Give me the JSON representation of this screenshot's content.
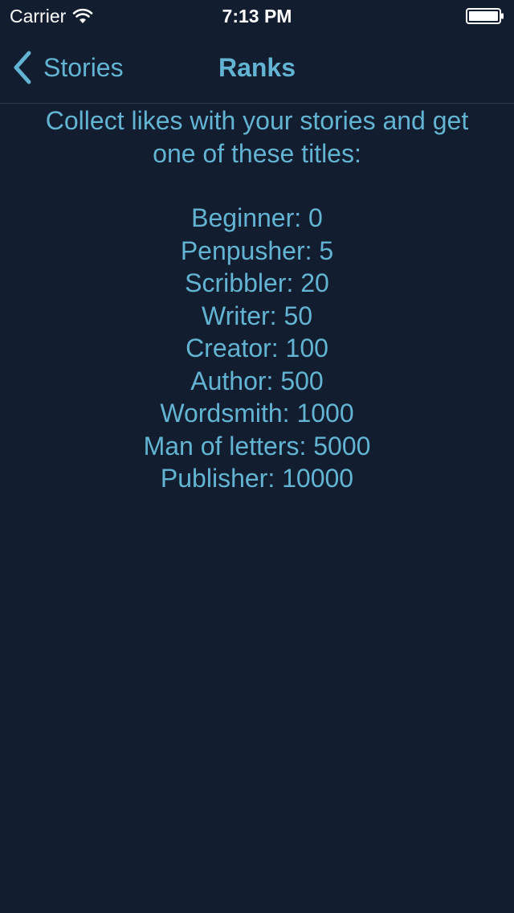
{
  "status_bar": {
    "carrier": "Carrier",
    "time": "7:13 PM",
    "wifi_icon": "wifi-icon",
    "battery_icon": "battery-icon"
  },
  "nav": {
    "back_label": "Stories",
    "back_icon": "chevron-left-icon",
    "title": "Ranks"
  },
  "content": {
    "intro_line1": "Collect likes with your stories and get",
    "intro_line2": "one of these titles:",
    "ranks": [
      "Beginner: 0",
      "Penpusher: 5",
      "Scribbler: 20",
      "Writer: 50",
      "Creator: 100",
      "Author: 500",
      "Wordsmith: 1000",
      "Man of letters: 5000",
      "Publisher: 10000"
    ]
  },
  "colors": {
    "background": "#121d30",
    "accent": "#62b4d2",
    "status_text": "#ffffff"
  }
}
